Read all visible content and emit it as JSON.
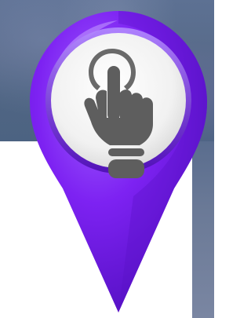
{
  "image": {
    "subject": "location-pin-with-tap-hand",
    "colors": {
      "pin_purple": "#7a1ff0",
      "pin_purple_light": "#9a55ff",
      "pin_purple_dark": "#5b10c8",
      "disc_white": "#f4f4f4",
      "icon_gray": "#5e5e5e",
      "background_blue_gray": "#566a8a"
    }
  }
}
